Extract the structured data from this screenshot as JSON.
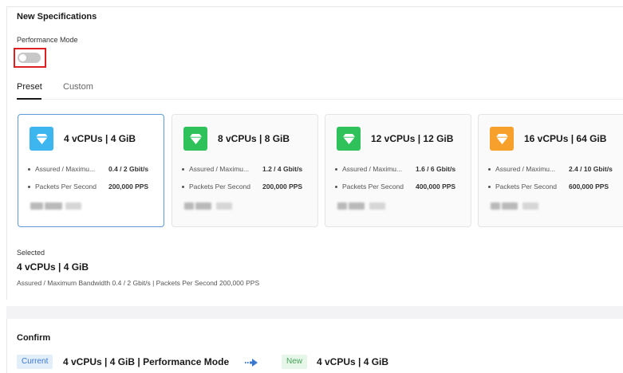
{
  "section": {
    "title": "New Specifications",
    "performance_label": "Performance Mode",
    "performance_enabled": false
  },
  "tabs": [
    {
      "label": "Preset",
      "active": true
    },
    {
      "label": "Custom",
      "active": false
    }
  ],
  "cards": [
    {
      "title": "4 vCPUs | 4 GiB",
      "icon": "gem-icon",
      "icon_color": "#3db5ee",
      "bw_label": "Assured / Maximu...",
      "bw_value": "0.4 / 2 Gbit/s",
      "pps_label": "Packets Per Second",
      "pps_value": "200,000 PPS",
      "selected": true
    },
    {
      "title": "8 vCPUs | 8 GiB",
      "icon": "gem-icon",
      "icon_color": "#2fc25b",
      "bw_label": "Assured / Maximu...",
      "bw_value": "1.2 / 4 Gbit/s",
      "pps_label": "Packets Per Second",
      "pps_value": "200,000 PPS",
      "selected": false
    },
    {
      "title": "12 vCPUs | 12 GiB",
      "icon": "gem-icon",
      "icon_color": "#2fc25b",
      "bw_label": "Assured / Maximu...",
      "bw_value": "1.6 / 6 Gbit/s",
      "pps_label": "Packets Per Second",
      "pps_value": "400,000 PPS",
      "selected": false
    },
    {
      "title": "16 vCPUs | 64 GiB",
      "icon": "gem-icon",
      "icon_color": "#f7a02c",
      "bw_label": "Assured / Maximu...",
      "bw_value": "2.4 / 10 Gbit/s",
      "pps_label": "Packets Per Second",
      "pps_value": "600,000 PPS",
      "selected": false
    }
  ],
  "selected": {
    "label": "Selected",
    "title": "4 vCPUs | 4 GiB",
    "detail": "Assured / Maximum Bandwidth  0.4 / 2 Gbit/s  |  Packets Per Second  200,000 PPS"
  },
  "confirm": {
    "title": "Confirm",
    "current_tag": "Current",
    "current_value": "4 vCPUs | 4 GiB | Performance Mode",
    "new_tag": "New",
    "new_value": "4 vCPUs | 4 GiB",
    "arrow_icon": "arrow-right-icon"
  },
  "colors": {
    "selected_border": "#5b9bd9",
    "toggle_highlight": "#e02020",
    "current_tag": "#3a78d0",
    "new_tag": "#47a45a"
  }
}
